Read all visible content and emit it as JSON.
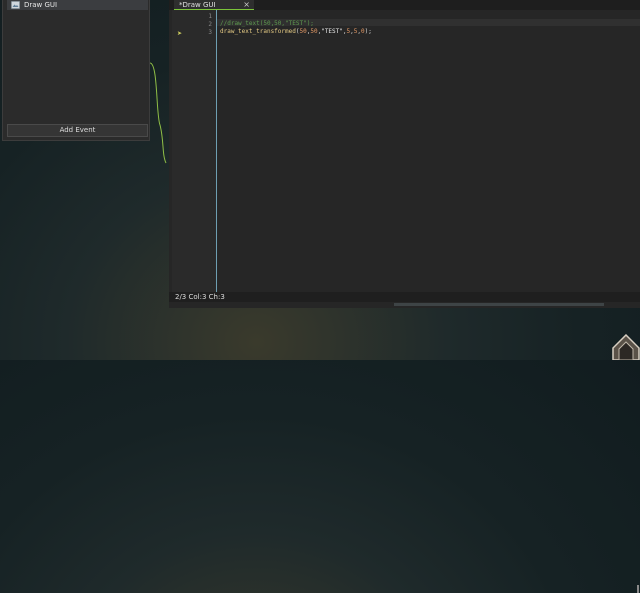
{
  "events_panel": {
    "items": [
      {
        "label": "Draw GUI",
        "icon": "draw-gui-icon"
      }
    ],
    "add_event_label": "Add Event"
  },
  "editor": {
    "tab": {
      "label": "*Draw GUI",
      "close_glyph": "×"
    },
    "line_numbers": [
      "1",
      "2",
      "3"
    ],
    "lines": [
      {
        "comment": ""
      },
      {
        "comment": "//draw_text(50,50,\"TEST\");"
      },
      {
        "fn": "draw_text_transformed",
        "open": "(",
        "a1": "50",
        "c1": ",",
        "a2": "50",
        "c2": ",",
        "str": "\"TEST\"",
        "c3": ",",
        "a3": "5",
        "c4": ",",
        "a4": "5",
        "c5": ",",
        "a5": "0",
        "close": ");"
      }
    ],
    "status": "2/3 Col:3 Ch:3"
  },
  "colors": {
    "accent_green": "#7cc43a",
    "comment": "#5e9a4f",
    "function": "#e3c983",
    "number": "#e69a66"
  }
}
